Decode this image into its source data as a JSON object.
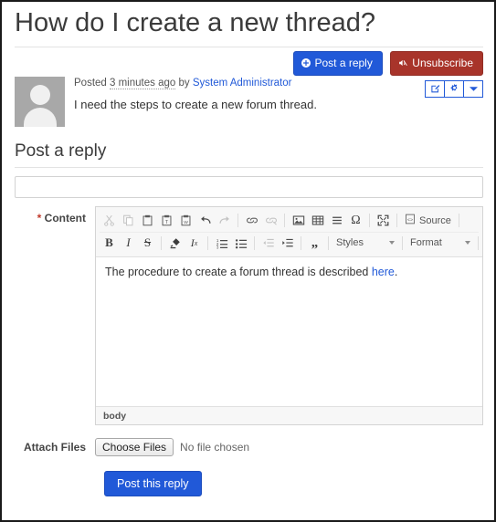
{
  "page": {
    "title": "How do I create a new thread?"
  },
  "post": {
    "actions": {
      "post_reply_label": "Post a reply",
      "post_reply_icon": "plus-circle-icon",
      "unsubscribe_label": "Unsubscribe",
      "unsubscribe_icon": "bell-mute-icon",
      "edit_icon": "edit-square-icon",
      "settings_icon": "gear-icon",
      "more_icon": "chevron-down-icon"
    },
    "avatar_icon": "user-avatar-placeholder",
    "posted_prefix": "Posted",
    "timestamp": "3 minutes ago",
    "by_word": "by",
    "author": "System Administrator",
    "body": "I need the steps to create a new forum thread."
  },
  "reply": {
    "section_title": "Post a reply",
    "title_input_value": "",
    "title_input_placeholder": "",
    "content_label": "Content",
    "required_marker": "*",
    "editor": {
      "toolbar_row1": [
        {
          "name": "cut-icon",
          "label": "Cut",
          "dim": true
        },
        {
          "name": "copy-icon",
          "label": "Copy",
          "dim": true
        },
        {
          "name": "paste-icon",
          "label": "Paste",
          "dim": false
        },
        {
          "name": "paste-text-icon",
          "label": "Paste as plain text",
          "dim": false
        },
        {
          "name": "paste-word-icon",
          "label": "Paste from Word",
          "dim": false
        },
        {
          "name": "undo-icon",
          "label": "Undo",
          "dim": false
        },
        {
          "name": "redo-icon",
          "label": "Redo",
          "dim": true
        },
        {
          "name": "link-icon",
          "label": "Link",
          "dim": false
        },
        {
          "name": "unlink-icon",
          "label": "Unlink",
          "dim": true
        },
        {
          "name": "image-icon",
          "label": "Image",
          "dim": false
        },
        {
          "name": "table-icon",
          "label": "Table",
          "dim": false
        },
        {
          "name": "horizontal-rule-icon",
          "label": "Horizontal line",
          "dim": false
        },
        {
          "name": "special-char-icon",
          "label": "Special character",
          "dim": false
        },
        {
          "name": "maximize-icon",
          "label": "Maximize",
          "dim": false
        }
      ],
      "source_label": "Source",
      "source_icon": "source-code-icon",
      "toolbar_row2": [
        {
          "name": "bold-icon",
          "label": "Bold",
          "dim": false
        },
        {
          "name": "italic-icon",
          "label": "Italic",
          "dim": false
        },
        {
          "name": "strikethrough-icon",
          "label": "Strikethrough",
          "dim": false
        },
        {
          "name": "remove-format-icon",
          "label": "Remove format",
          "dim": false
        },
        {
          "name": "subscript-icon",
          "label": "Remove inline style",
          "dim": false
        },
        {
          "name": "numbered-list-icon",
          "label": "Insert/Remove Numbered List",
          "dim": false
        },
        {
          "name": "bulleted-list-icon",
          "label": "Insert/Remove Bulleted List",
          "dim": false
        },
        {
          "name": "outdent-icon",
          "label": "Decrease Indent",
          "dim": true
        },
        {
          "name": "indent-icon",
          "label": "Increase Indent",
          "dim": false
        },
        {
          "name": "blockquote-icon",
          "label": "Block Quote",
          "dim": false
        }
      ],
      "styles_label": "Styles",
      "format_label": "Format",
      "content_text_before": "The procedure to create a forum thread is described ",
      "content_link_text": "here",
      "content_text_after": ".",
      "element_path": "body"
    },
    "attach_label": "Attach Files",
    "choose_files_label": "Choose Files",
    "no_file_label": "No file chosen",
    "submit_label": "Post this reply"
  },
  "colors": {
    "primary": "#2159d8",
    "danger": "#a8342a",
    "link": "#2159d8",
    "required": "#c0392b",
    "avatar_bg": "#a8a8a8"
  }
}
